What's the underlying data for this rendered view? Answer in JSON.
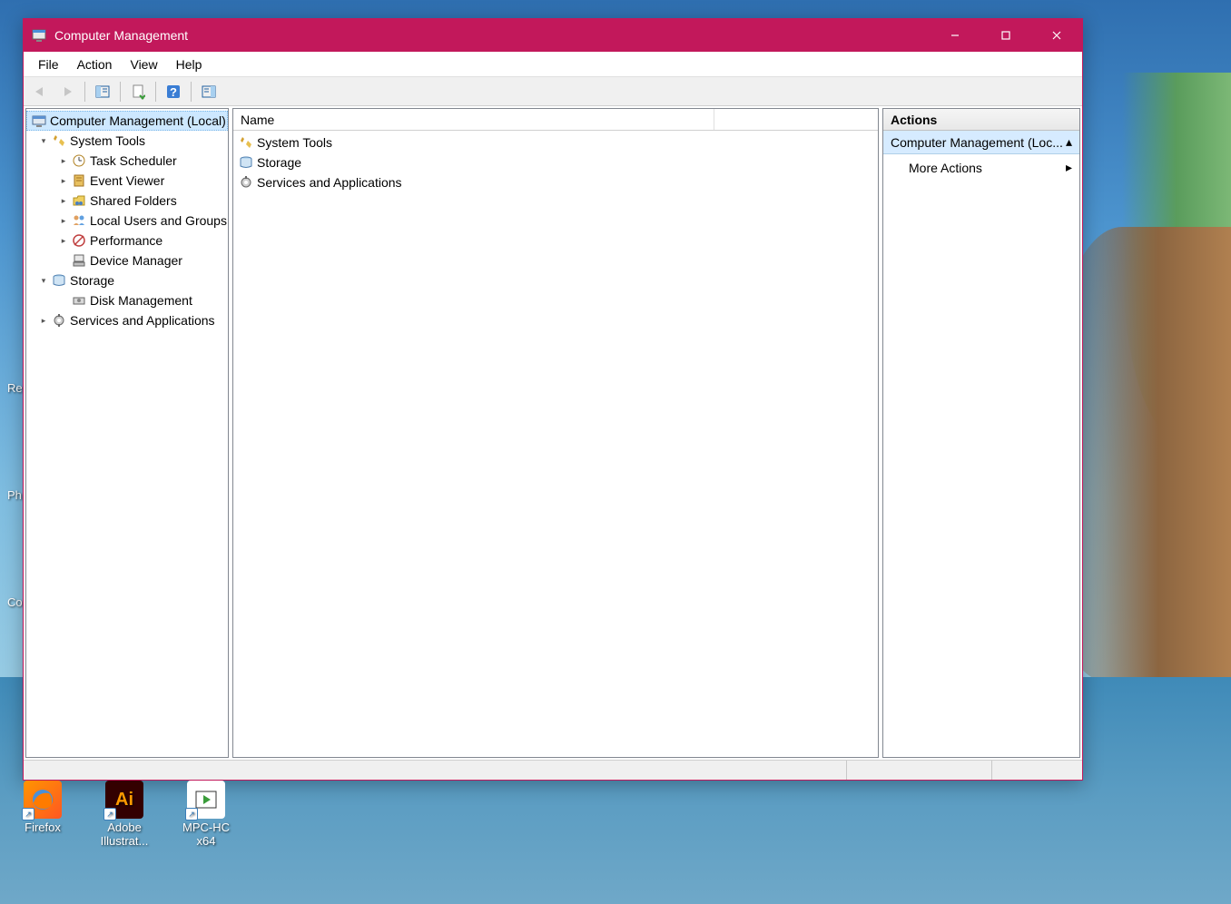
{
  "window": {
    "title": "Computer Management"
  },
  "menubar": [
    "File",
    "Action",
    "View",
    "Help"
  ],
  "tree": {
    "root": "Computer Management (Local)",
    "system_tools": "System Tools",
    "task_scheduler": "Task Scheduler",
    "event_viewer": "Event Viewer",
    "shared_folders": "Shared Folders",
    "local_users": "Local Users and Groups",
    "performance": "Performance",
    "device_manager": "Device Manager",
    "storage": "Storage",
    "disk_management": "Disk Management",
    "services_apps": "Services and Applications"
  },
  "list": {
    "header_name": "Name",
    "items": {
      "system_tools": "System Tools",
      "storage": "Storage",
      "services_apps": "Services and Applications"
    }
  },
  "actions": {
    "header": "Actions",
    "group": "Computer Management (Loc...",
    "more": "More Actions"
  },
  "desktop": {
    "firefox": "Firefox",
    "illustrator": "Adobe Illustrat...",
    "mpc": "MPC-HC x64",
    "partial_re": "Re",
    "partial_ph": "Ph",
    "partial_co": "Co"
  }
}
